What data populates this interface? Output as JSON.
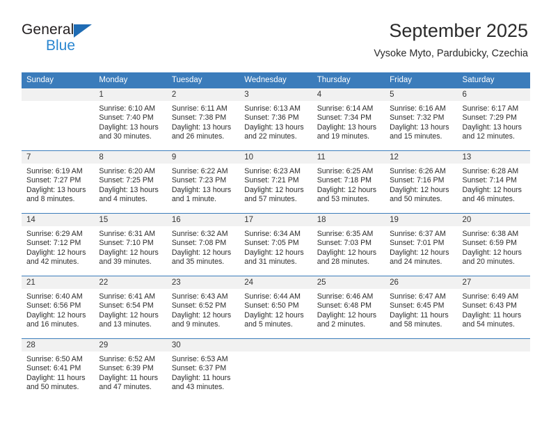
{
  "brand": {
    "name_top": "General",
    "name_bottom": "Blue",
    "triangle_icon": "triangle-icon",
    "colors": {
      "dark": "#231f20",
      "blue": "#2a86d0",
      "triangle": "#1f6cb4"
    }
  },
  "header": {
    "title": "September 2025",
    "subtitle": "Vysoke Myto, Pardubicky, Czechia"
  },
  "theme": {
    "header_row_bg": "#3b7cbb",
    "header_row_text": "#ffffff",
    "daynum_band_bg": "#f1f1f1",
    "grid_line": "#3b7cbb"
  },
  "weekdays": [
    "Sunday",
    "Monday",
    "Tuesday",
    "Wednesday",
    "Thursday",
    "Friday",
    "Saturday"
  ],
  "weeks": [
    [
      {
        "day": "",
        "sunrise": "",
        "sunset": "",
        "daylight": "",
        "empty": true
      },
      {
        "day": "1",
        "sunrise": "Sunrise: 6:10 AM",
        "sunset": "Sunset: 7:40 PM",
        "daylight": "Daylight: 13 hours and 30 minutes.",
        "empty": false
      },
      {
        "day": "2",
        "sunrise": "Sunrise: 6:11 AM",
        "sunset": "Sunset: 7:38 PM",
        "daylight": "Daylight: 13 hours and 26 minutes.",
        "empty": false
      },
      {
        "day": "3",
        "sunrise": "Sunrise: 6:13 AM",
        "sunset": "Sunset: 7:36 PM",
        "daylight": "Daylight: 13 hours and 22 minutes.",
        "empty": false
      },
      {
        "day": "4",
        "sunrise": "Sunrise: 6:14 AM",
        "sunset": "Sunset: 7:34 PM",
        "daylight": "Daylight: 13 hours and 19 minutes.",
        "empty": false
      },
      {
        "day": "5",
        "sunrise": "Sunrise: 6:16 AM",
        "sunset": "Sunset: 7:32 PM",
        "daylight": "Daylight: 13 hours and 15 minutes.",
        "empty": false
      },
      {
        "day": "6",
        "sunrise": "Sunrise: 6:17 AM",
        "sunset": "Sunset: 7:29 PM",
        "daylight": "Daylight: 13 hours and 12 minutes.",
        "empty": false
      }
    ],
    [
      {
        "day": "7",
        "sunrise": "Sunrise: 6:19 AM",
        "sunset": "Sunset: 7:27 PM",
        "daylight": "Daylight: 13 hours and 8 minutes.",
        "empty": false
      },
      {
        "day": "8",
        "sunrise": "Sunrise: 6:20 AM",
        "sunset": "Sunset: 7:25 PM",
        "daylight": "Daylight: 13 hours and 4 minutes.",
        "empty": false
      },
      {
        "day": "9",
        "sunrise": "Sunrise: 6:22 AM",
        "sunset": "Sunset: 7:23 PM",
        "daylight": "Daylight: 13 hours and 1 minute.",
        "empty": false
      },
      {
        "day": "10",
        "sunrise": "Sunrise: 6:23 AM",
        "sunset": "Sunset: 7:21 PM",
        "daylight": "Daylight: 12 hours and 57 minutes.",
        "empty": false
      },
      {
        "day": "11",
        "sunrise": "Sunrise: 6:25 AM",
        "sunset": "Sunset: 7:18 PM",
        "daylight": "Daylight: 12 hours and 53 minutes.",
        "empty": false
      },
      {
        "day": "12",
        "sunrise": "Sunrise: 6:26 AM",
        "sunset": "Sunset: 7:16 PM",
        "daylight": "Daylight: 12 hours and 50 minutes.",
        "empty": false
      },
      {
        "day": "13",
        "sunrise": "Sunrise: 6:28 AM",
        "sunset": "Sunset: 7:14 PM",
        "daylight": "Daylight: 12 hours and 46 minutes.",
        "empty": false
      }
    ],
    [
      {
        "day": "14",
        "sunrise": "Sunrise: 6:29 AM",
        "sunset": "Sunset: 7:12 PM",
        "daylight": "Daylight: 12 hours and 42 minutes.",
        "empty": false
      },
      {
        "day": "15",
        "sunrise": "Sunrise: 6:31 AM",
        "sunset": "Sunset: 7:10 PM",
        "daylight": "Daylight: 12 hours and 39 minutes.",
        "empty": false
      },
      {
        "day": "16",
        "sunrise": "Sunrise: 6:32 AM",
        "sunset": "Sunset: 7:08 PM",
        "daylight": "Daylight: 12 hours and 35 minutes.",
        "empty": false
      },
      {
        "day": "17",
        "sunrise": "Sunrise: 6:34 AM",
        "sunset": "Sunset: 7:05 PM",
        "daylight": "Daylight: 12 hours and 31 minutes.",
        "empty": false
      },
      {
        "day": "18",
        "sunrise": "Sunrise: 6:35 AM",
        "sunset": "Sunset: 7:03 PM",
        "daylight": "Daylight: 12 hours and 28 minutes.",
        "empty": false
      },
      {
        "day": "19",
        "sunrise": "Sunrise: 6:37 AM",
        "sunset": "Sunset: 7:01 PM",
        "daylight": "Daylight: 12 hours and 24 minutes.",
        "empty": false
      },
      {
        "day": "20",
        "sunrise": "Sunrise: 6:38 AM",
        "sunset": "Sunset: 6:59 PM",
        "daylight": "Daylight: 12 hours and 20 minutes.",
        "empty": false
      }
    ],
    [
      {
        "day": "21",
        "sunrise": "Sunrise: 6:40 AM",
        "sunset": "Sunset: 6:56 PM",
        "daylight": "Daylight: 12 hours and 16 minutes.",
        "empty": false
      },
      {
        "day": "22",
        "sunrise": "Sunrise: 6:41 AM",
        "sunset": "Sunset: 6:54 PM",
        "daylight": "Daylight: 12 hours and 13 minutes.",
        "empty": false
      },
      {
        "day": "23",
        "sunrise": "Sunrise: 6:43 AM",
        "sunset": "Sunset: 6:52 PM",
        "daylight": "Daylight: 12 hours and 9 minutes.",
        "empty": false
      },
      {
        "day": "24",
        "sunrise": "Sunrise: 6:44 AM",
        "sunset": "Sunset: 6:50 PM",
        "daylight": "Daylight: 12 hours and 5 minutes.",
        "empty": false
      },
      {
        "day": "25",
        "sunrise": "Sunrise: 6:46 AM",
        "sunset": "Sunset: 6:48 PM",
        "daylight": "Daylight: 12 hours and 2 minutes.",
        "empty": false
      },
      {
        "day": "26",
        "sunrise": "Sunrise: 6:47 AM",
        "sunset": "Sunset: 6:45 PM",
        "daylight": "Daylight: 11 hours and 58 minutes.",
        "empty": false
      },
      {
        "day": "27",
        "sunrise": "Sunrise: 6:49 AM",
        "sunset": "Sunset: 6:43 PM",
        "daylight": "Daylight: 11 hours and 54 minutes.",
        "empty": false
      }
    ],
    [
      {
        "day": "28",
        "sunrise": "Sunrise: 6:50 AM",
        "sunset": "Sunset: 6:41 PM",
        "daylight": "Daylight: 11 hours and 50 minutes.",
        "empty": false
      },
      {
        "day": "29",
        "sunrise": "Sunrise: 6:52 AM",
        "sunset": "Sunset: 6:39 PM",
        "daylight": "Daylight: 11 hours and 47 minutes.",
        "empty": false
      },
      {
        "day": "30",
        "sunrise": "Sunrise: 6:53 AM",
        "sunset": "Sunset: 6:37 PM",
        "daylight": "Daylight: 11 hours and 43 minutes.",
        "empty": false
      },
      {
        "day": "",
        "sunrise": "",
        "sunset": "",
        "daylight": "",
        "empty": true
      },
      {
        "day": "",
        "sunrise": "",
        "sunset": "",
        "daylight": "",
        "empty": true
      },
      {
        "day": "",
        "sunrise": "",
        "sunset": "",
        "daylight": "",
        "empty": true
      },
      {
        "day": "",
        "sunrise": "",
        "sunset": "",
        "daylight": "",
        "empty": true
      }
    ]
  ]
}
